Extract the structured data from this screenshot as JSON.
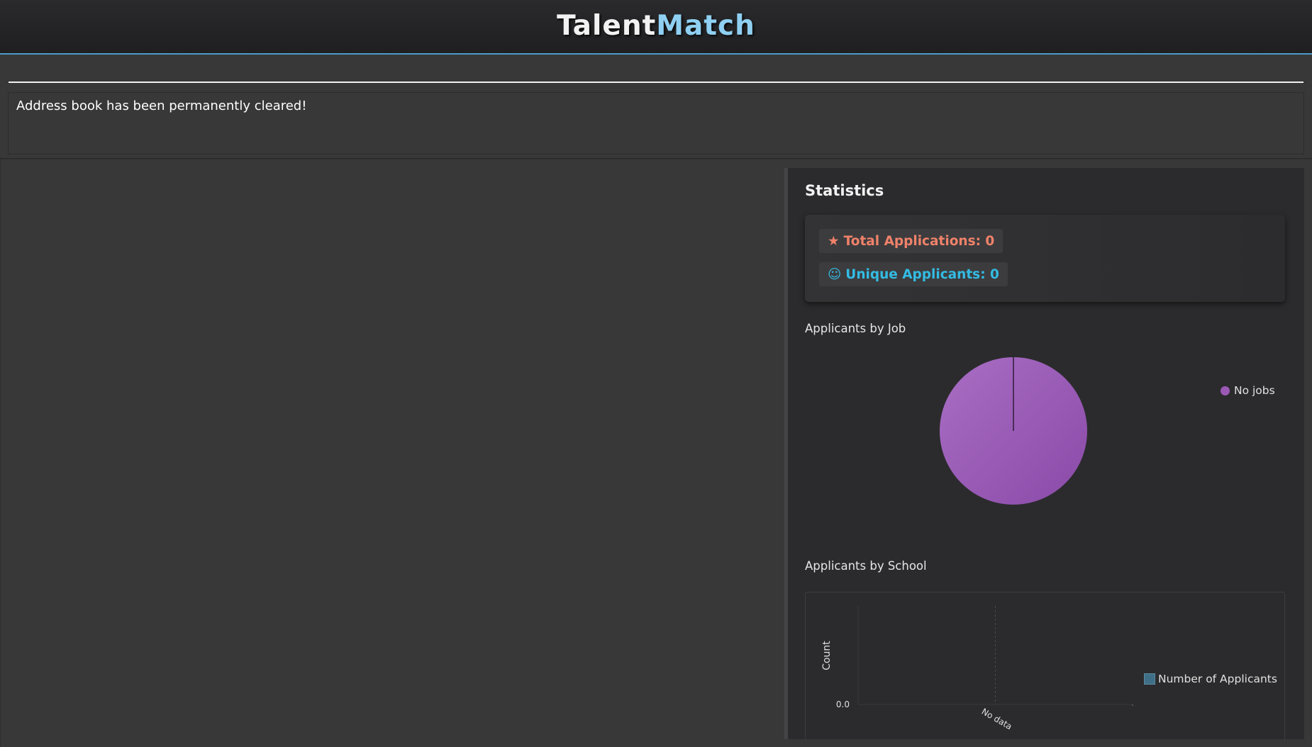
{
  "app": {
    "title_part1": "Talent",
    "title_part2": "Match"
  },
  "command": {
    "value": "",
    "placeholder": ""
  },
  "result": {
    "message": "Address book has been permanently cleared!"
  },
  "statistics": {
    "title": "Statistics",
    "total_label": "Total Applications: 0",
    "unique_label": "Unique Applicants: 0",
    "total_icon": "★",
    "unique_icon": "☺",
    "colors": {
      "total": "#f0826a",
      "unique": "#33bce4",
      "pie": "#9b59b6",
      "bar": "#3f6f86"
    }
  },
  "pie_section": {
    "label": "Applicants by Job"
  },
  "bar_section": {
    "label": "Applicants by School"
  },
  "chart_data": [
    {
      "type": "pie",
      "title": "Applicants by Job",
      "labels": [
        "No jobs"
      ],
      "values": [
        1
      ],
      "legend_position": "right"
    },
    {
      "type": "bar",
      "title": "Applicants by School",
      "categories": [
        "No data"
      ],
      "series": [
        {
          "name": "Number of Applicants",
          "values": [
            0
          ]
        }
      ],
      "xlabel": "",
      "ylabel": "Count",
      "y_ticks": [
        "0.0"
      ],
      "legend_position": "right"
    }
  ]
}
